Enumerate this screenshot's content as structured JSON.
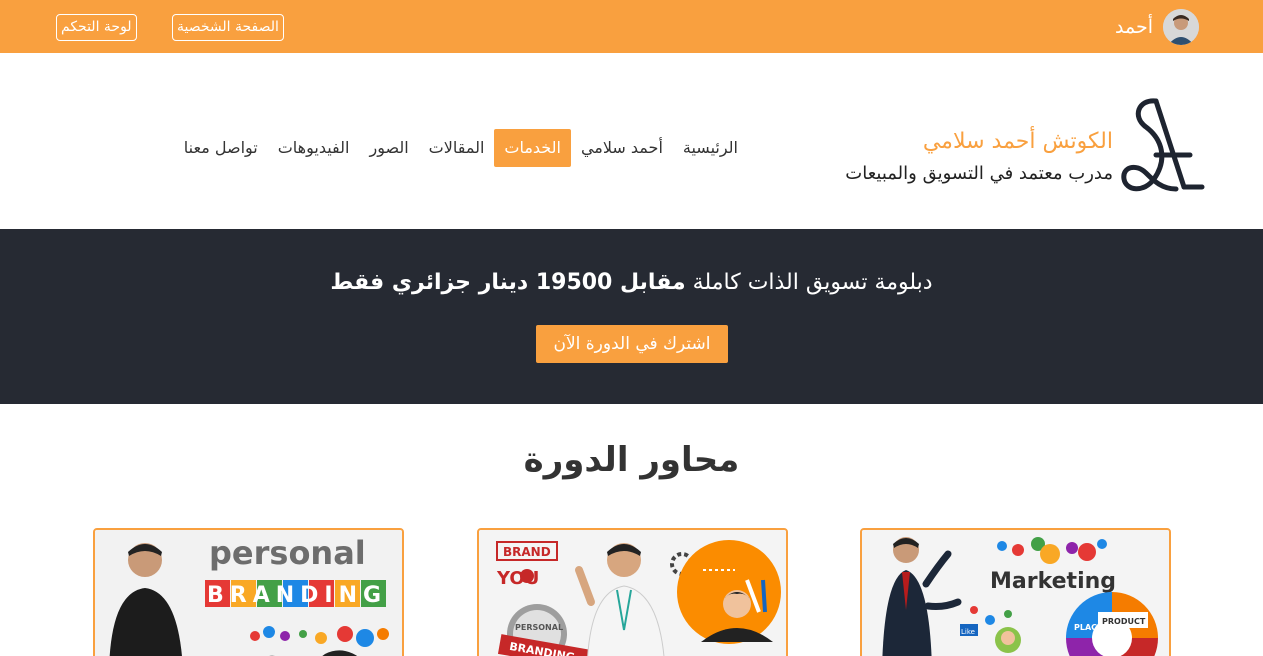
{
  "topbar": {
    "dashboard_label": "لوحة التحكم",
    "profile_label": "الصفحة الشخصية",
    "user_name": "أحمد"
  },
  "header": {
    "brand_name": "الكوتش أحمد سلامي",
    "brand_subtitle": "مدرب معتمد في التسويق والمبيعات",
    "nav": [
      {
        "label": "الرئيسية"
      },
      {
        "label": "أحمد سلامي"
      },
      {
        "label": "الخدمات",
        "active": true
      },
      {
        "label": "المقالات"
      },
      {
        "label": "الصور"
      },
      {
        "label": "الفيديوهات"
      },
      {
        "label": "تواصل معنا"
      }
    ]
  },
  "banner": {
    "text_prefix": "دبلومة تسويق الذات كاملة",
    "text_bold": "مقابل 19500 دينار جزائري فقط",
    "cta_label": "اشترك في الدورة الآن"
  },
  "section": {
    "title": "محاور الدورة"
  },
  "cards": [
    {
      "image_text_1": "personal",
      "image_text_2": "BRANDING"
    },
    {
      "image_text_1": "BRAND",
      "image_text_2": "YOU",
      "image_text_3": "PERSONAL",
      "image_text_4": "BRANDING"
    },
    {
      "image_text_1": "Marketing",
      "image_text_2": "PLACE",
      "image_text_3": "PRODUCT",
      "image_text_4": "Like"
    }
  ],
  "colors": {
    "accent": "#f9a03f",
    "dark": "#262a33"
  }
}
